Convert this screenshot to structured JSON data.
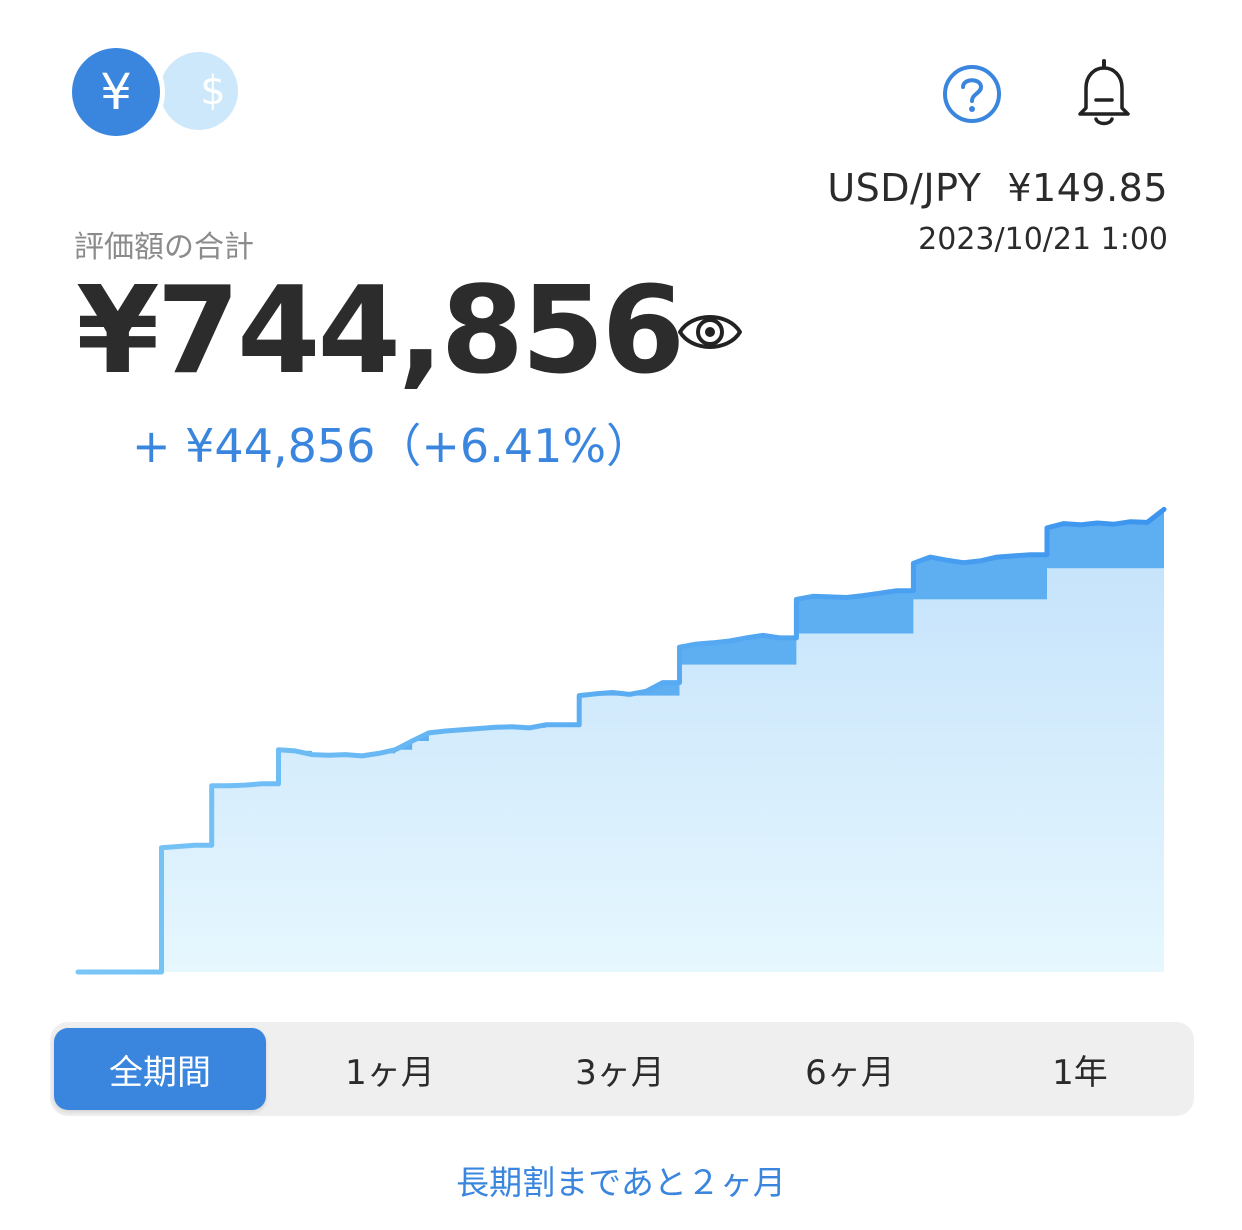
{
  "currency_toggle": {
    "jpy_symbol": "¥",
    "usd_symbol": "$"
  },
  "header": {
    "help_icon": "question-circle-icon",
    "bell_icon": "bell-icon"
  },
  "fx": {
    "pair": "USD/JPY",
    "rate": "¥149.85",
    "timestamp": "2023/10/21 1:00"
  },
  "summary": {
    "label": "評価額の合計",
    "total": "¥744,856",
    "gain": "+ ¥44,856（+6.41%）",
    "visibility_icon": "eye-icon"
  },
  "colors": {
    "accent": "#3a86df",
    "line_start": "#7ac6f6",
    "line_end": "#3b94ee",
    "gain_band": "#5eaef2",
    "area_top": "#c4e2fb",
    "area_bottom": "#e6f7fe"
  },
  "chart_data": {
    "type": "area",
    "grid": false,
    "legend": "none",
    "ylim": [
      0,
      760000
    ],
    "series": [
      {
        "role": "valuation",
        "values": [
          0,
          0,
          0,
          0,
          0,
          200000,
          202000,
          204000,
          300000,
          300000,
          301000,
          303000,
          358000,
          356000,
          350000,
          349000,
          350000,
          348000,
          352000,
          358000,
          372000,
          385000,
          388000,
          390000,
          392000,
          394000,
          395000,
          393000,
          398000,
          398000,
          445000,
          448000,
          450000,
          447000,
          452000,
          466000,
          523000,
          528000,
          530000,
          533000,
          538000,
          542000,
          538000,
          600000,
          605000,
          604000,
          603000,
          606000,
          610000,
          614000,
          658000,
          668000,
          663000,
          659000,
          662000,
          668000,
          670000,
          672000,
          715000,
          722000,
          720000,
          723000,
          721000,
          725000,
          724000,
          744856
        ]
      },
      {
        "role": "invested",
        "values": [
          0,
          0,
          0,
          0,
          0,
          200000,
          202000,
          204000,
          300000,
          300000,
          301000,
          303000,
          358000,
          356000,
          350000,
          349000,
          350000,
          348000,
          352000,
          358000,
          372000,
          385000,
          388000,
          390000,
          392000,
          394000,
          395000,
          393000,
          398000,
          398000,
          445000,
          445000,
          445000,
          445000,
          445000,
          445000,
          495000,
          495000,
          495000,
          495000,
          495000,
          495000,
          495000,
          545000,
          545000,
          545000,
          545000,
          545000,
          545000,
          545000,
          600000,
          600000,
          600000,
          600000,
          600000,
          600000,
          600000,
          600000,
          650000,
          650000,
          650000,
          650000,
          650000,
          650000,
          650000,
          700000
        ]
      }
    ]
  },
  "periods": [
    {
      "label": "全期間",
      "active": true
    },
    {
      "label": "1ヶ月",
      "active": false
    },
    {
      "label": "3ヶ月",
      "active": false
    },
    {
      "label": "6ヶ月",
      "active": false
    },
    {
      "label": "1年",
      "active": false
    }
  ],
  "footer_note": "長期割まであと２ヶ月"
}
